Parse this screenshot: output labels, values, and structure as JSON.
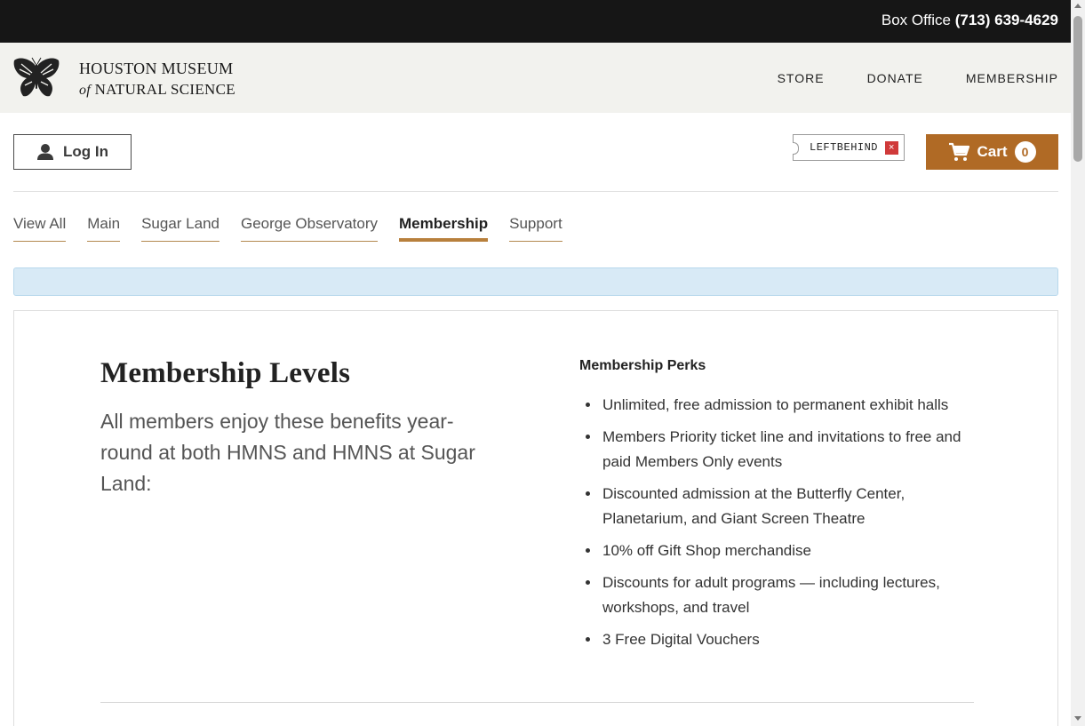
{
  "topbar": {
    "box_office_label": "Box Office",
    "phone": "(713) 639-4629"
  },
  "logo": {
    "line1": "HOUSTON MUSEUM",
    "line2_italic": "of",
    "line2": "NATURAL SCIENCE"
  },
  "topnav": {
    "items": [
      {
        "label": "STORE"
      },
      {
        "label": "DONATE"
      },
      {
        "label": "MEMBERSHIP"
      }
    ]
  },
  "account": {
    "login_label": "Log In"
  },
  "promo": {
    "code": "LEFTBEHIND",
    "remove_symbol": "×"
  },
  "cart": {
    "label": "Cart",
    "count": "0"
  },
  "subnav": {
    "items": [
      {
        "label": "View All",
        "active": false
      },
      {
        "label": "Main",
        "active": false
      },
      {
        "label": "Sugar Land",
        "active": false
      },
      {
        "label": "George Observatory",
        "active": false
      },
      {
        "label": "Membership",
        "active": true
      },
      {
        "label": "Support",
        "active": false
      }
    ]
  },
  "main": {
    "title": "Membership Levels",
    "description": "All members enjoy these benefits year-round at both HMNS and HMNS at Sugar Land:",
    "perks_title": "Membership Perks",
    "perks": [
      "Unlimited, free admission to permanent exhibit halls",
      "Members Priority ticket line and invitations to free and paid Members Only events",
      "Discounted admission at the Butterfly Center, Planetarium, and Giant Screen Theatre",
      "10% off Gift Shop merchandise",
      "Discounts for adult programs — including lectures, workshops, and travel",
      "3 Free Digital Vouchers"
    ]
  },
  "colors": {
    "accent": "#b06a25",
    "info_bar": "#d8eaf6",
    "topbar": "#161616",
    "header": "#f2f2ee"
  }
}
